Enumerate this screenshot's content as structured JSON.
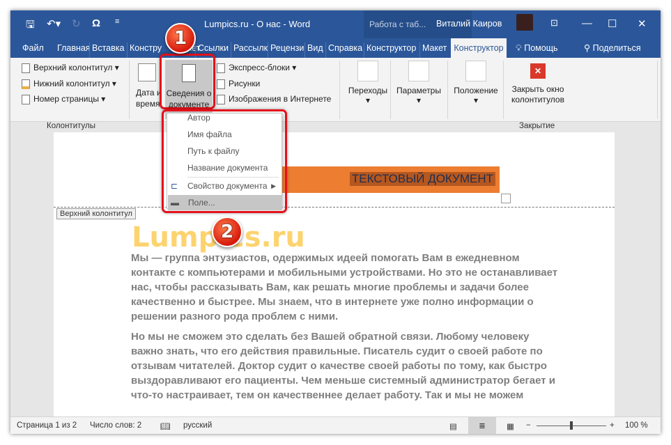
{
  "window": {
    "title": "Lumpics.ru - О нас  -  Word",
    "context_group": "Работа с таб...",
    "user": "Виталий Каиров"
  },
  "tabs": [
    "Файл",
    "Главная",
    "Вставка",
    "Констру",
    "Макет",
    "Ссылки",
    "Рассылк",
    "Рецензи",
    "Вид",
    "Справка",
    "Конструктор",
    "Макет",
    "Конструктор"
  ],
  "tell_me": "Помощь",
  "share": "Поделиться",
  "ribbon": {
    "header": "Верхний колонтитул",
    "footer": "Нижний колонтитул",
    "page_number": "Номер страницы",
    "group1": "Колонтитулы",
    "date_time": [
      "Дата и",
      "время"
    ],
    "doc_info": [
      "Сведения о",
      "документе"
    ],
    "quick_parts": "Экспресс-блоки",
    "pictures": "Рисунки",
    "online_pictures": "Изображения в Интернете",
    "navigation": "Переходы",
    "options": "Параметры",
    "position": "Положение",
    "close": [
      "Закрыть окно",
      "колонтитулов"
    ],
    "group_close": "Закрытие"
  },
  "menu": [
    "Автор",
    "Имя файла",
    "Путь к файлу",
    "Название документа",
    "Свойство документа",
    "Поле..."
  ],
  "document": {
    "header_label": "Верхний колонтитул",
    "banner": "ТЕКСТОВЫЙ ДОКУМЕНТ",
    "logo": "Lumpics.ru",
    "p1": [
      "Мы — группа энтузиастов, одержимых идеей помогать Вам в ежедневном",
      "контакте с компьютерами и мобильными устройствами. Но это не останавливает",
      "нас, чтобы рассказывать Вам, как решать многие проблемы и задачи более",
      "качественно и быстрее. Мы знаем, что в интернете уже полно информации о",
      "решении разного рода проблем с ними."
    ],
    "p2": [
      "Но мы не сможем это сделать без Вашей обратной связи. Любому человеку",
      "важно знать, что его действия правильные. Писатель судит о своей работе по",
      "отзывам читателей. Доктор судит о качестве своей работы по тому, как быстро",
      "выздоравливают его пациенты. Чем меньше системный администратор бегает и",
      "что-то настраивает, тем он качественнее делает работу. Так и мы не можем"
    ]
  },
  "status": {
    "page": "Страница 1 из 2",
    "words": "Число слов: 2",
    "language": "русский",
    "zoom": "100 %",
    "zoom_percent": 100
  },
  "callouts": [
    "1",
    "2"
  ]
}
